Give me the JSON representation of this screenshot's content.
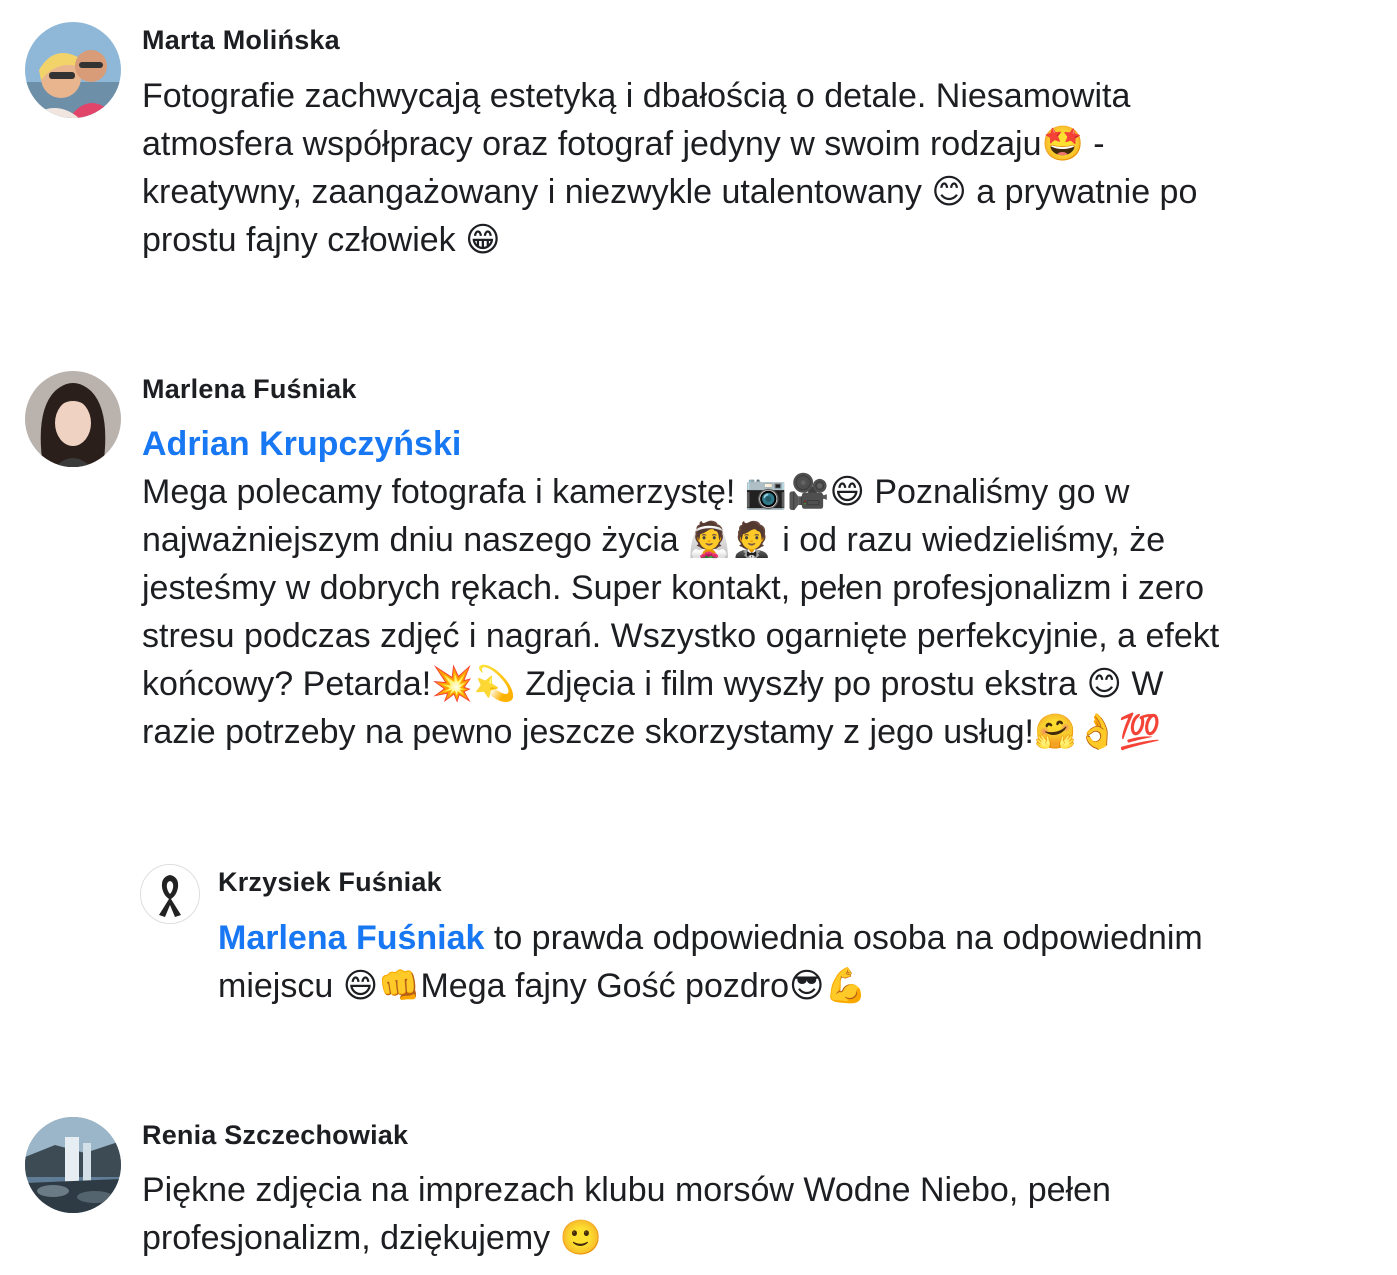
{
  "comments": [
    {
      "author": "Marta Molińska",
      "lines": [
        "Fotografie zachwycają estetyką i dbałością o detale. Niesamowita",
        "atmosfera współpracy oraz fotograf jedyny w swoim rodzaju🤩 -",
        "kreatywny, zaangażowany i niezwykle utalentowany 😊 a prywatnie po",
        "prostu fajny człowiek 😁"
      ]
    },
    {
      "author": "Marlena Fuśniak",
      "mention": "Adrian Krupczyński",
      "lines": [
        "Mega polecamy fotografa i kamerzystę! 📷🎥😄 Poznaliśmy go w",
        "najważniejszym dniu naszego życia 👰🤵 i od razu wiedzieliśmy, że",
        "jesteśmy w dobrych rękach. Super kontakt, pełen profesjonalizm i zero",
        "stresu podczas zdjęć i nagrań. Wszystko ogarnięte perfekcyjnie, a efekt",
        "końcowy? Petarda!💥💫 Zdjęcia i film wyszły po prostu ekstra 😊 W",
        "razie potrzeby na pewno jeszcze skorzystamy z jego usług!🤗👌💯"
      ]
    },
    {
      "author": "Krzysiek Fuśniak",
      "mention": "Marlena Fuśniak",
      "line1_rest": " to prawda odpowiednia osoba na odpowiednim",
      "line2": "miejscu 😄👊Mega fajny Gość pozdro😎💪"
    },
    {
      "author": "Renia Szczechowiak",
      "lines": [
        "Piękne zdjęcia na imprezach klubu morsów Wodne Niebo, pełen",
        "profesjonalizm, dziękujemy 🙂"
      ]
    }
  ]
}
